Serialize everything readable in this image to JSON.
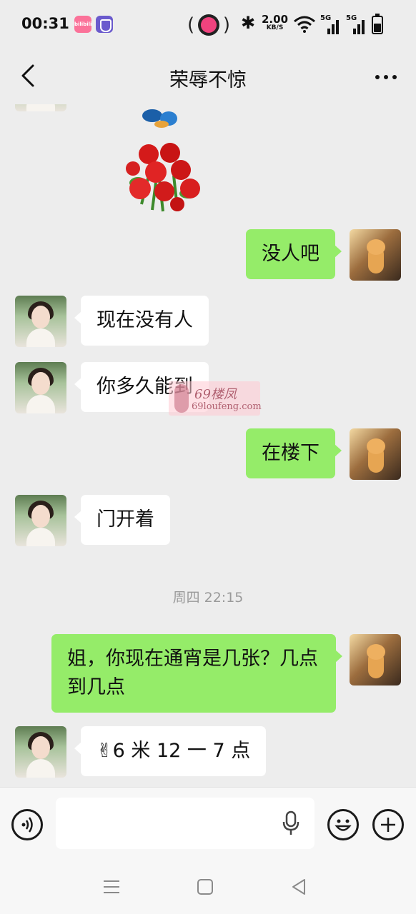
{
  "status_bar": {
    "time": "00:31",
    "bili_label": "bilibili",
    "speed_value": "2.00",
    "speed_unit": "KB/S",
    "net1": "5G",
    "net2": "5G",
    "icons": [
      "bilibili-icon",
      "shield-app-icon",
      "recording-pill-icon",
      "bluetooth-icon",
      "wifi-icon",
      "signal-icon",
      "battery-icon"
    ]
  },
  "header": {
    "title": "荣辱不惊",
    "back_icon": "chevron-left-icon",
    "more_icon": "more-dots-icon"
  },
  "messages": [
    {
      "side": "out",
      "text": "没人吧"
    },
    {
      "side": "in",
      "text": "现在没有人"
    },
    {
      "side": "in",
      "text": "你多久能到"
    },
    {
      "side": "out",
      "text": "在楼下"
    },
    {
      "side": "in",
      "text": "门开着"
    },
    {
      "side": "out",
      "text": "姐，你现在通宵是几张？几点到几点"
    },
    {
      "side": "in",
      "text": "✌6 米 12 一 7 点"
    }
  ],
  "timestamp": "周四 22:15",
  "watermark": {
    "line1": "69楼凤",
    "line2": "69loufeng.com"
  },
  "input_bar": {
    "voice_icon": "voice-icon",
    "mic_icon": "microphone-icon",
    "emoji_icon": "emoji-icon",
    "plus_icon": "plus-icon",
    "placeholder": ""
  },
  "nav_bar": {
    "icons": [
      "menu-icon",
      "home-square-icon",
      "back-triangle-icon"
    ]
  },
  "colors": {
    "background": "#ededed",
    "outgoing_bubble": "#95ec69",
    "incoming_bubble": "#ffffff"
  }
}
